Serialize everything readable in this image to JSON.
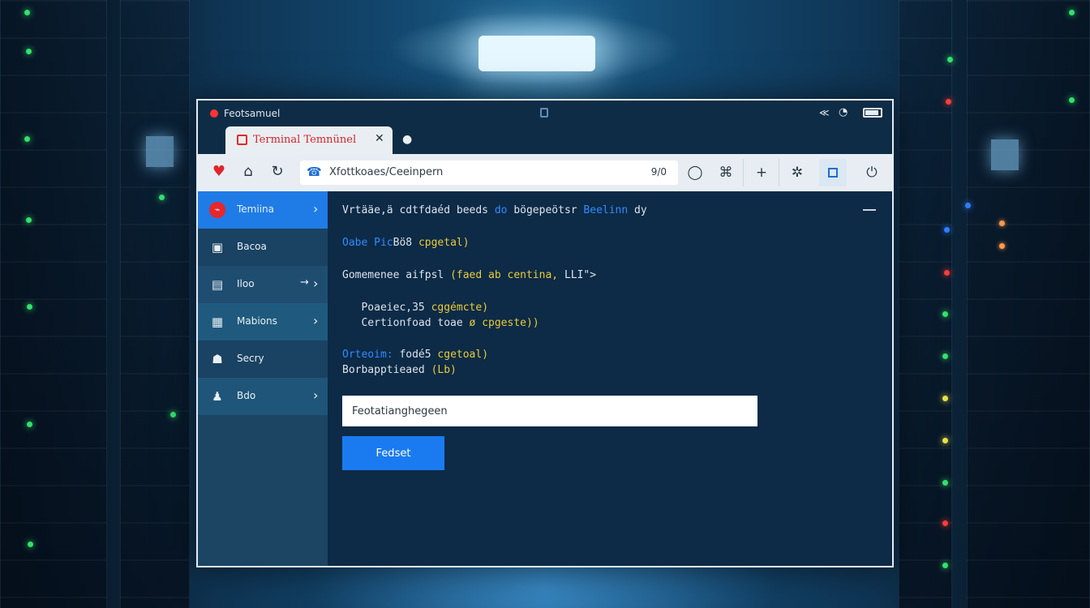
{
  "window": {
    "title": "Feotsamuel"
  },
  "tabs": [
    {
      "label": "Terminal Temnünel"
    }
  ],
  "toolbar": {
    "url": "Xfottkoaes/Ceeinpern",
    "zoom": "9/0"
  },
  "sidebar": {
    "items": [
      {
        "label": "Temiina"
      },
      {
        "label": "Bacoa"
      },
      {
        "label": "Iloo"
      },
      {
        "label": "Mabions"
      },
      {
        "label": "Secry"
      },
      {
        "label": "Bdo"
      }
    ]
  },
  "terminal": {
    "line1": {
      "a": "Vrtääe,ä cdtfdaéd beeds ",
      "b": "do ",
      "c": "bögepeötsr ",
      "d": "Beelinn ",
      "e": "dy"
    },
    "line2": {
      "a": "Oabe Pic",
      "b": "Bö8 ",
      "c": "cpgetal)"
    },
    "line3": {
      "a": "Gomemenee aifpsl ",
      "b": "(faed ab centina, ",
      "c": "LLI\">"
    },
    "line4": {
      "a": "   Poaeiec,35 ",
      "b": "cggémcte)"
    },
    "line5": {
      "a": "   Certionfoad toae ",
      "b": "ø ",
      "c": "cpgeste))"
    },
    "line6": {
      "a": "Orteoim: ",
      "b": "fodé5 ",
      "c": "cgetoal)"
    },
    "line7": {
      "a": "Borbapptieaed ",
      "b": "(Lb)"
    }
  },
  "form": {
    "input_value": "Feotatianghegeen",
    "submit_label": "Fedset"
  },
  "colors": {
    "accent": "#1a7bf0",
    "tab_text": "#d8232a",
    "highlight_blue": "#2f8cff",
    "highlight_yellow": "#e8cc3a"
  }
}
